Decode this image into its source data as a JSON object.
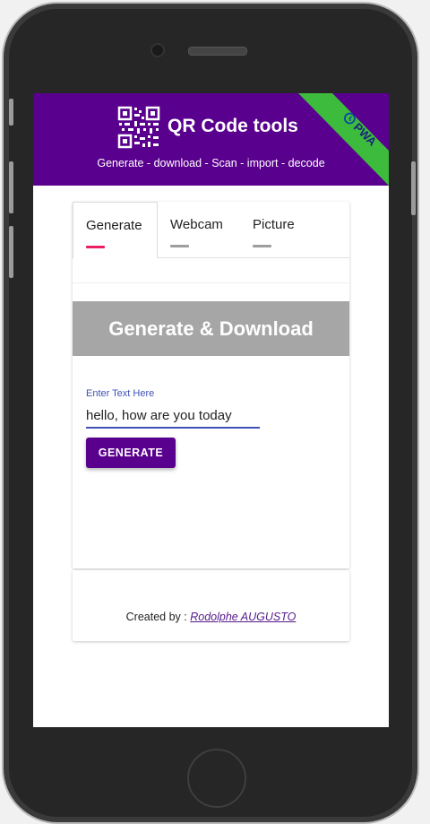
{
  "header": {
    "title": "QR Code tools",
    "subtitle": "Generate - download - Scan - import - decode",
    "badge": "PWA",
    "colors": {
      "primary": "#59008e",
      "badge": "#3dbb3d"
    }
  },
  "tabs": [
    {
      "label": "Generate",
      "active": true,
      "underline_color": "#e91e63"
    },
    {
      "label": "Webcam",
      "active": false,
      "underline_color": "#9e9e9e"
    },
    {
      "label": "Picture",
      "active": false,
      "underline_color": "#9e9e9e"
    }
  ],
  "generate": {
    "heading": "Generate & Download",
    "input_label": "Enter Text Here",
    "input_value": "hello, how are you today",
    "button_label": "GENERATE"
  },
  "footer": {
    "prefix": "Created by : ",
    "author": "Rodolphe AUGUSTO"
  }
}
